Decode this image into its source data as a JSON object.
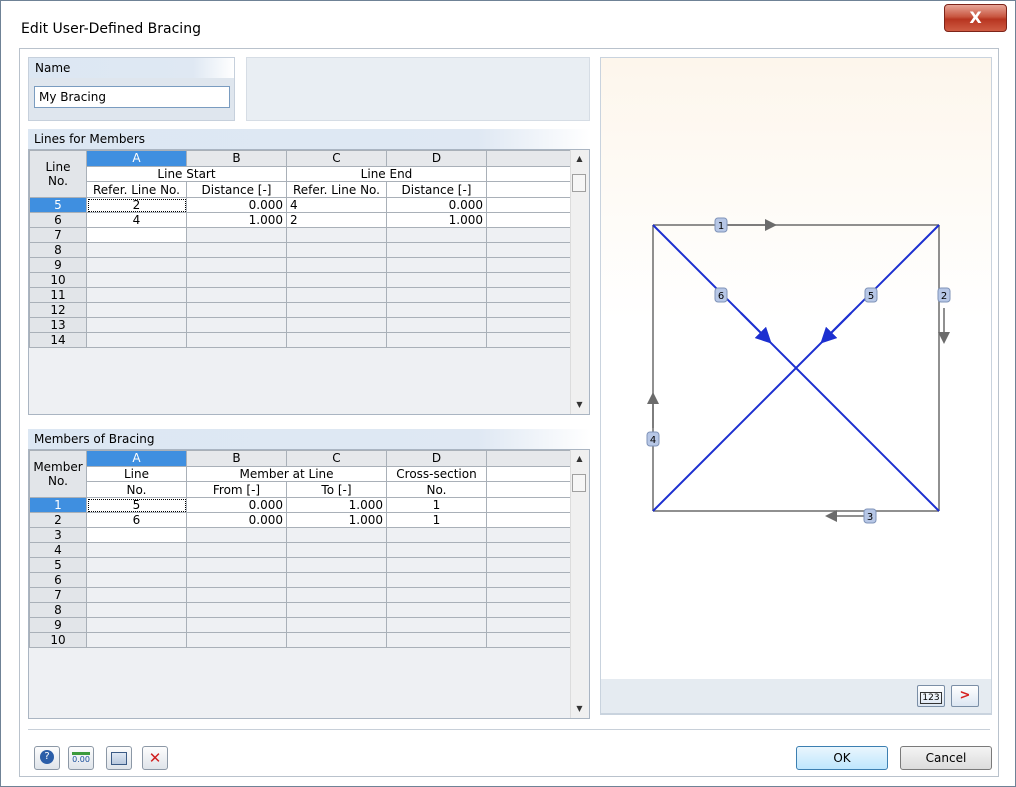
{
  "window": {
    "title": "Edit User-Defined Bracing",
    "close_glyph": "X"
  },
  "name_section": {
    "label": "Name",
    "value": "My Bracing"
  },
  "lines_section": {
    "label": "Lines for Members",
    "col_letters": [
      "A",
      "B",
      "C",
      "D"
    ],
    "group_headers": {
      "row_header_top": "Line",
      "row_header_bottom": "No.",
      "line_start": "Line Start",
      "line_end": "Line End"
    },
    "sub_headers": [
      "Refer. Line No.",
      "Distance [-]",
      "Refer. Line No.",
      "Distance [-]"
    ],
    "rows": [
      {
        "no": "5",
        "a": "2",
        "b": "0.000",
        "c": "4",
        "d": "0.000"
      },
      {
        "no": "6",
        "a": "4",
        "b": "1.000",
        "c": "2",
        "d": "1.000"
      },
      {
        "no": "7",
        "a": "",
        "b": "",
        "c": "",
        "d": ""
      },
      {
        "no": "8",
        "a": "",
        "b": "",
        "c": "",
        "d": ""
      },
      {
        "no": "9",
        "a": "",
        "b": "",
        "c": "",
        "d": ""
      },
      {
        "no": "10",
        "a": "",
        "b": "",
        "c": "",
        "d": ""
      },
      {
        "no": "11",
        "a": "",
        "b": "",
        "c": "",
        "d": ""
      },
      {
        "no": "12",
        "a": "",
        "b": "",
        "c": "",
        "d": ""
      },
      {
        "no": "13",
        "a": "",
        "b": "",
        "c": "",
        "d": ""
      },
      {
        "no": "14",
        "a": "",
        "b": "",
        "c": "",
        "d": ""
      }
    ]
  },
  "members_section": {
    "label": "Members of Bracing",
    "col_letters": [
      "A",
      "B",
      "C",
      "D"
    ],
    "group_headers": {
      "row_header_top": "Member",
      "row_header_bottom": "No.",
      "a_top": "Line",
      "a_bottom": "No.",
      "member_at_line": "Member at Line",
      "d_top": "Cross-section",
      "d_bottom": "No."
    },
    "sub_headers": [
      "From [-]",
      "To [-]"
    ],
    "rows": [
      {
        "no": "1",
        "a": "5",
        "b": "0.000",
        "c": "1.000",
        "d": "1"
      },
      {
        "no": "2",
        "a": "6",
        "b": "0.000",
        "c": "1.000",
        "d": "1"
      },
      {
        "no": "3",
        "a": "",
        "b": "",
        "c": "",
        "d": ""
      },
      {
        "no": "4",
        "a": "",
        "b": "",
        "c": "",
        "d": ""
      },
      {
        "no": "5",
        "a": "",
        "b": "",
        "c": "",
        "d": ""
      },
      {
        "no": "6",
        "a": "",
        "b": "",
        "c": "",
        "d": ""
      },
      {
        "no": "7",
        "a": "",
        "b": "",
        "c": "",
        "d": ""
      },
      {
        "no": "8",
        "a": "",
        "b": "",
        "c": "",
        "d": ""
      },
      {
        "no": "9",
        "a": "",
        "b": "",
        "c": "",
        "d": ""
      },
      {
        "no": "10",
        "a": "",
        "b": "",
        "c": "",
        "d": ""
      }
    ]
  },
  "diagram": {
    "line_labels": [
      "1",
      "2",
      "3",
      "4",
      "5",
      "6"
    ],
    "colors": {
      "frame": "#6b6b6b",
      "bracing": "#1c2fd0",
      "label_bg": "#b7c7e6"
    },
    "numbering_button": "123",
    "next_glyph": ">"
  },
  "footer": {
    "icons": [
      "help-icon",
      "decimal-places-icon",
      "units-icon",
      "delete-icon"
    ],
    "decimal_label": "0.00",
    "ok_label": "OK",
    "cancel_label": "Cancel"
  }
}
